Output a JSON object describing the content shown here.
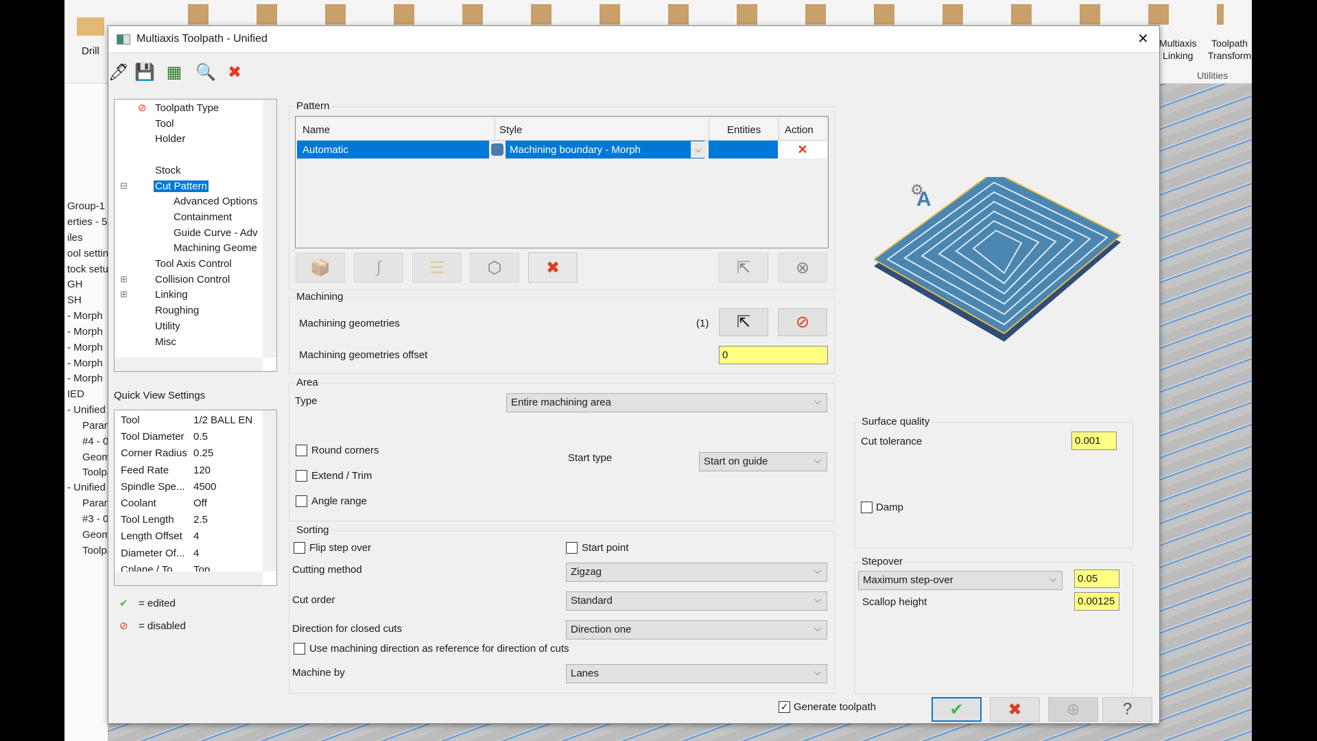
{
  "ribbon": {
    "drill_label": "Drill",
    "multiaxis_linking": [
      "Multiaxis",
      "Linking"
    ],
    "toolpath_transform": [
      "Toolpath",
      "Transform"
    ],
    "utilities_label": "Utilities"
  },
  "app_tree": [
    "Group-1",
    "erties - 5",
    "iles",
    "ool settin",
    "tock setu",
    "GH",
    "SH",
    "- Morph",
    "- Morph",
    "- Morph",
    "- Morph",
    "- Morph",
    "IED",
    "- Unified",
    "Param",
    "#4 - 0",
    "Geome",
    "Toolpa",
    "- Unified",
    "Param",
    "#3 - 0",
    "Geome",
    "Toolpa"
  ],
  "dialog": {
    "title": "Multiaxis Toolpath - Unified",
    "close": "✕"
  },
  "toolbar": [
    "tool-icon",
    "save-icon",
    "save-as-icon",
    "preview-icon",
    "close-window-icon"
  ],
  "nav_tree": {
    "items": [
      "Toolpath Type",
      "Tool",
      "Holder",
      "",
      "Stock",
      "Cut Pattern",
      "Advanced Options",
      "Containment",
      "Guide Curve - Adv",
      "Machining Geome",
      "Tool Axis Control",
      "Collision Control",
      "Linking",
      "Roughing",
      "Utility",
      "Misc"
    ],
    "selected": "Cut Pattern"
  },
  "quick_view": {
    "title": "Quick View Settings",
    "rows": [
      [
        "Tool",
        "1/2 BALL EN"
      ],
      [
        "Tool Diameter",
        "0.5"
      ],
      [
        "Corner Radius",
        "0.25"
      ],
      [
        "Feed Rate",
        "120"
      ],
      [
        "Spindle Spe...",
        "4500"
      ],
      [
        "Coolant",
        "Off"
      ],
      [
        "Tool Length",
        "2.5"
      ],
      [
        "Length Offset",
        "4"
      ],
      [
        "Diameter Of...",
        "4"
      ],
      [
        "Cplane / To...",
        "Top"
      ]
    ]
  },
  "legend": {
    "edited": "= edited",
    "disabled": "= disabled"
  },
  "pattern": {
    "label": "Pattern",
    "columns": [
      "Name",
      "Style",
      "Entities",
      "Action"
    ],
    "row": {
      "name": "Automatic",
      "style": "Machining boundary - Morph",
      "entities": "",
      "action": "✕"
    }
  },
  "machining": {
    "label": "Machining",
    "geometries_label": "Machining geometries",
    "geometries_count": "(1)",
    "offset_label": "Machining geometries offset",
    "offset_value": "0"
  },
  "area": {
    "label": "Area",
    "type_label": "Type",
    "type_value": "Entire machining area",
    "round_corners": "Round corners",
    "extend_trim": "Extend / Trim",
    "angle_range": "Angle range",
    "start_type_label": "Start type",
    "start_type_value": "Start on guide"
  },
  "sorting": {
    "label": "Sorting",
    "flip_step_over": "Flip step over",
    "start_point": "Start point",
    "cutting_method_label": "Cutting method",
    "cutting_method": "Zigzag",
    "cut_order_label": "Cut order",
    "cut_order": "Standard",
    "direction_label": "Direction for closed cuts",
    "direction": "Direction one",
    "use_machining_dir": "Use machining direction as reference for direction of cuts",
    "machine_by_label": "Machine by",
    "machine_by": "Lanes"
  },
  "surface_quality": {
    "label": "Surface quality",
    "cut_tolerance_label": "Cut tolerance",
    "cut_tolerance": "0.001",
    "damp": "Damp"
  },
  "stepover": {
    "label": "Stepover",
    "mode": "Maximum step-over",
    "value": "0.05",
    "scallop_label": "Scallop height",
    "scallop": "0.00125"
  },
  "footer": {
    "generate_toolpath": "Generate toolpath",
    "generate_checked": true
  },
  "colors": {
    "selection": "#0078d7",
    "input_yellow": "#ffff80",
    "danger": "#e03a1e",
    "ok": "#3cb94a"
  }
}
